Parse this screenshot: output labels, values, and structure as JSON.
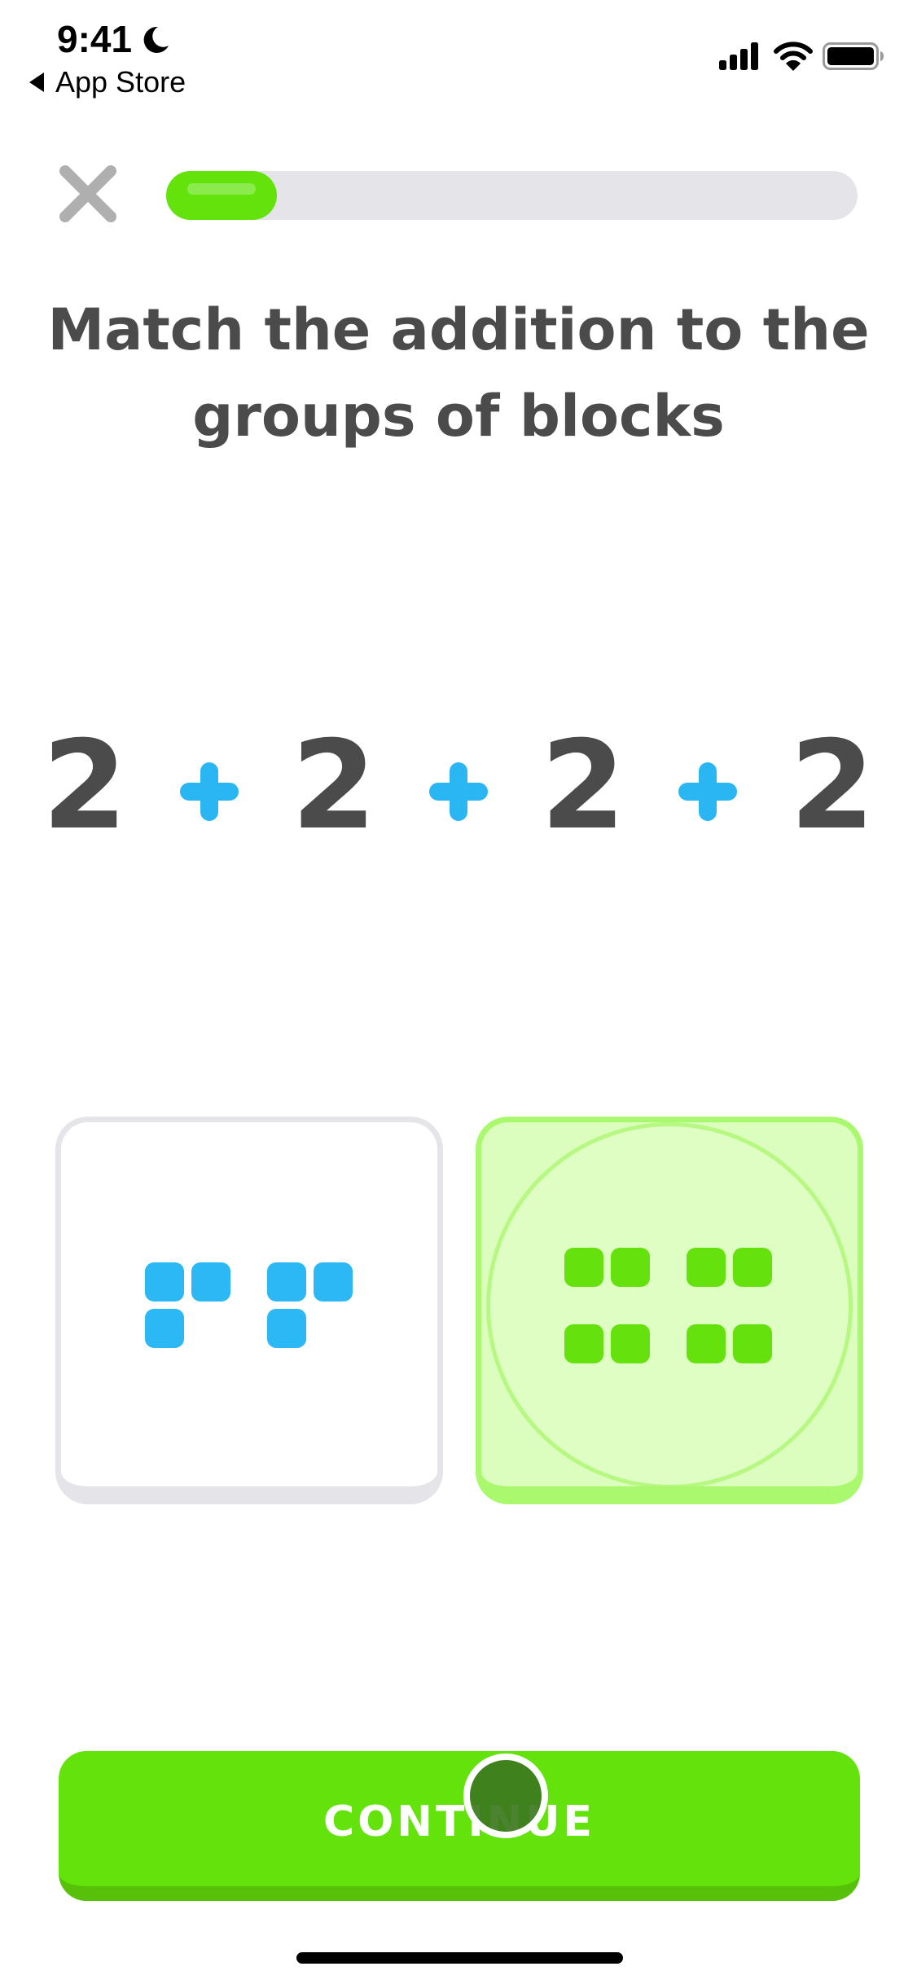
{
  "status_bar": {
    "time": "9:41",
    "focus_icon": "moon-icon",
    "back_label": "App Store",
    "icons": [
      "cellular-signal-icon",
      "wifi-icon",
      "battery-icon"
    ]
  },
  "lesson": {
    "close_icon": "close-icon",
    "progress": 0.16,
    "prompt": "Match the addition to the groups of blocks",
    "equation": {
      "terms": [
        "2",
        "2",
        "2",
        "2"
      ],
      "operator": "+"
    }
  },
  "options": [
    {
      "id": "option-1",
      "selected": false,
      "groups": 2,
      "blocks_per_group": 3,
      "color": "#2cb8f4"
    },
    {
      "id": "option-2",
      "selected": true,
      "groups": 4,
      "blocks_per_group": 2,
      "color": "#65e20e"
    }
  ],
  "footer": {
    "continue_label": "CONTINUE"
  },
  "colors": {
    "accent_green": "#63e20c",
    "accent_blue": "#2ab6f3",
    "text_dark": "#4b4b4b",
    "track_gray": "#e5e4e8"
  }
}
